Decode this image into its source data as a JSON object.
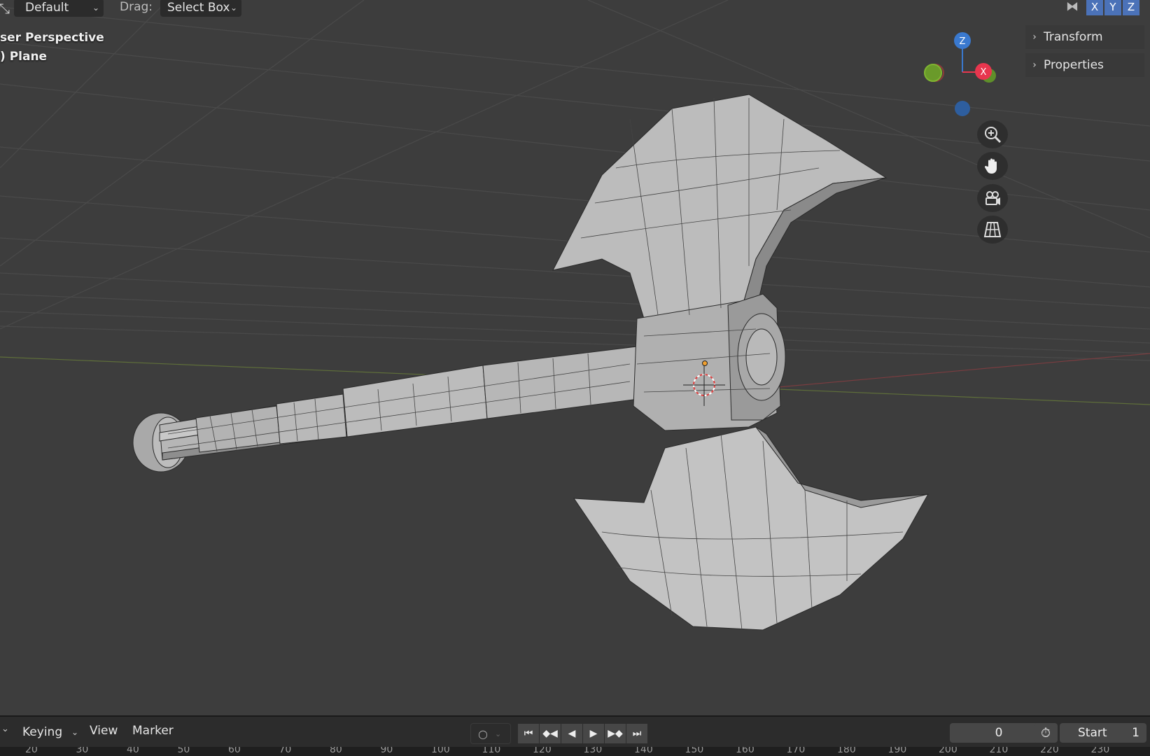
{
  "header": {
    "orientation_value": "Default",
    "drag_label": "Drag:",
    "drag_value": "Select Box",
    "axis_buttons": [
      "X",
      "Y",
      "Z"
    ]
  },
  "overlay": {
    "view_name": "ser Perspective",
    "object_info": ") Plane"
  },
  "gizmo": {
    "z_label": "Z",
    "x_label": "X",
    "colors": {
      "x": "#e8364e",
      "y": "#7fb531",
      "z": "#3a79cf"
    }
  },
  "sidebar": {
    "items": [
      {
        "label": "Transform"
      },
      {
        "label": "Properties"
      }
    ]
  },
  "nav_icons": [
    "zoom-icon",
    "pan-hand-icon",
    "camera-icon",
    "grid-icon"
  ],
  "timeline": {
    "menu": [
      "Keying",
      "View",
      "Marker"
    ],
    "current_frame": "0",
    "start_label": "Start",
    "start_value": "1",
    "ruler": [
      "20",
      "30",
      "40",
      "50",
      "60",
      "70",
      "80",
      "90",
      "100",
      "110",
      "120",
      "130",
      "140",
      "150",
      "160",
      "170",
      "180",
      "190",
      "200",
      "210",
      "220",
      "230"
    ]
  }
}
